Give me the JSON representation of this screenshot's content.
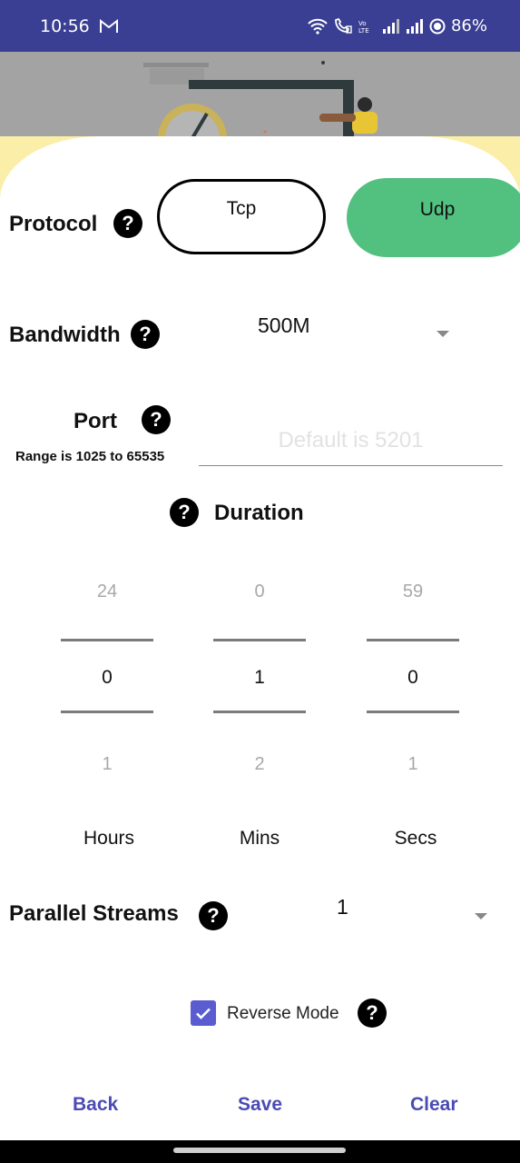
{
  "status_bar": {
    "time": "10:56",
    "battery": "86%",
    "icons": [
      "gmail-icon",
      "wifi-icon",
      "wifi-calling-icon",
      "volte-icon",
      "signal-icon",
      "signal-icon",
      "battery-saver-icon"
    ]
  },
  "protocol": {
    "label": "Protocol",
    "options": [
      "Tcp",
      "Udp"
    ],
    "selected": "Udp"
  },
  "bandwidth": {
    "label": "Bandwidth",
    "value": "500M"
  },
  "port": {
    "label": "Port",
    "range_text": "Range is 1025 to 65535",
    "placeholder": "Default is 5201",
    "value": ""
  },
  "duration": {
    "label": "Duration",
    "pickers": [
      {
        "unit": "Hours",
        "prev": "24",
        "current": "0",
        "next": "1"
      },
      {
        "unit": "Mins",
        "prev": "0",
        "current": "1",
        "next": "2"
      },
      {
        "unit": "Secs",
        "prev": "59",
        "current": "0",
        "next": "1"
      }
    ]
  },
  "parallel_streams": {
    "label": "Parallel Streams",
    "value": "1"
  },
  "reverse_mode": {
    "label": "Reverse Mode",
    "checked": true
  },
  "actions": {
    "back": "Back",
    "save": "Save",
    "clear": "Clear"
  },
  "help_glyph": "?",
  "colors": {
    "status_bar": "#3a3f93",
    "udp_selected": "#52c07f",
    "accent": "#4b4bb5",
    "checkbox": "#5a5cd0",
    "hero_yellow": "#fbeea8"
  }
}
